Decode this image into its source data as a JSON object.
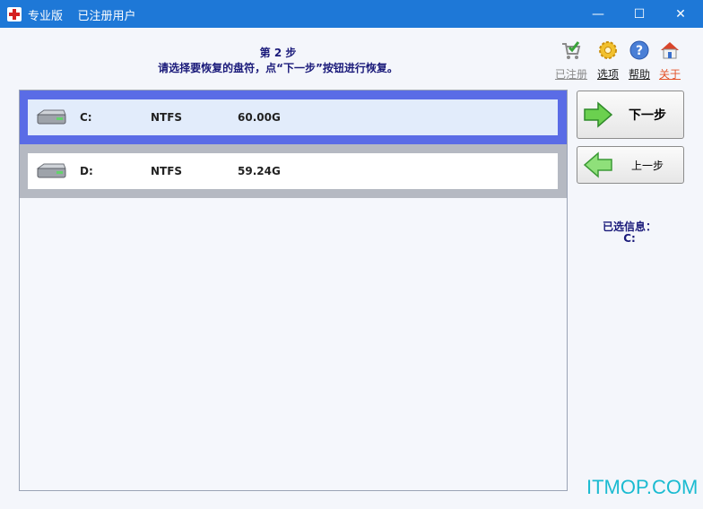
{
  "window": {
    "title": "专业版    已注册用户",
    "minimize": "—",
    "maximize": "☐",
    "close": "✕"
  },
  "header": {
    "step": "第 2 步",
    "instruction": "请选择要恢复的盘符，点“下一步”按钮进行恢复。"
  },
  "toolbar": [
    {
      "id": "register",
      "label": "已注册",
      "icon": "cart-check-icon",
      "color": "#8a8a8a"
    },
    {
      "id": "options",
      "label": "选项",
      "icon": "gear-icon",
      "color": "#1a1a1a"
    },
    {
      "id": "help",
      "label": "帮助",
      "icon": "help-icon",
      "color": "#1a1a1a"
    },
    {
      "id": "about",
      "label": "关于",
      "icon": "home-icon",
      "color": "#e4532a"
    }
  ],
  "disks": [
    {
      "letter": "C:",
      "fs": "NTFS",
      "size": "60.00G",
      "selected": true
    },
    {
      "letter": "D:",
      "fs": "NTFS",
      "size": "59.24G",
      "selected": false
    }
  ],
  "buttons": {
    "next": "下一步",
    "prev": "上一步"
  },
  "selection": {
    "title": "已选信息：",
    "value": "C:"
  },
  "watermark": "ITMOP.COM"
}
